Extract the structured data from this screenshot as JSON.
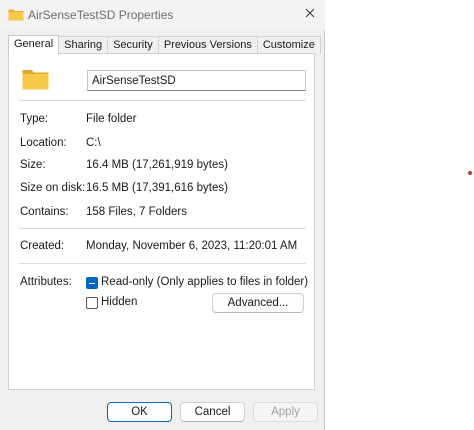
{
  "window": {
    "title": "AirSenseTestSD Properties"
  },
  "tabs": [
    {
      "label": "General",
      "active": true
    },
    {
      "label": "Sharing",
      "active": false
    },
    {
      "label": "Security",
      "active": false
    },
    {
      "label": "Previous Versions",
      "active": false
    },
    {
      "label": "Customize",
      "active": false
    }
  ],
  "general": {
    "name_value": "AirSenseTestSD",
    "properties": [
      {
        "label": "Type:",
        "value": "File folder"
      },
      {
        "label": "Location:",
        "value": "C:\\"
      },
      {
        "label": "Size:",
        "value": "16.4 MB (17,261,919 bytes)"
      },
      {
        "label": "Size on disk:",
        "value": "16.5 MB (17,391,616 bytes)"
      },
      {
        "label": "Contains:",
        "value": "158 Files, 7 Folders"
      }
    ],
    "created": {
      "label": "Created:",
      "value": "Monday, November 6, 2023, 11:20:01 AM"
    },
    "attributes": {
      "label": "Attributes:",
      "readonly": {
        "label": "Read-only (Only applies to files in folder)",
        "checked": true,
        "state": "indeterminate"
      },
      "hidden": {
        "label": "Hidden",
        "checked": false
      },
      "advanced_label": "Advanced..."
    }
  },
  "buttons": {
    "ok": "OK",
    "cancel": "Cancel",
    "apply": "Apply"
  },
  "colors": {
    "accent": "#0067c0",
    "folder_yellow": "#f8c948",
    "window_bg": "#f0f0f0"
  },
  "icons": {
    "title": "folder-icon",
    "close": "close-icon",
    "panel": "folder-icon"
  }
}
